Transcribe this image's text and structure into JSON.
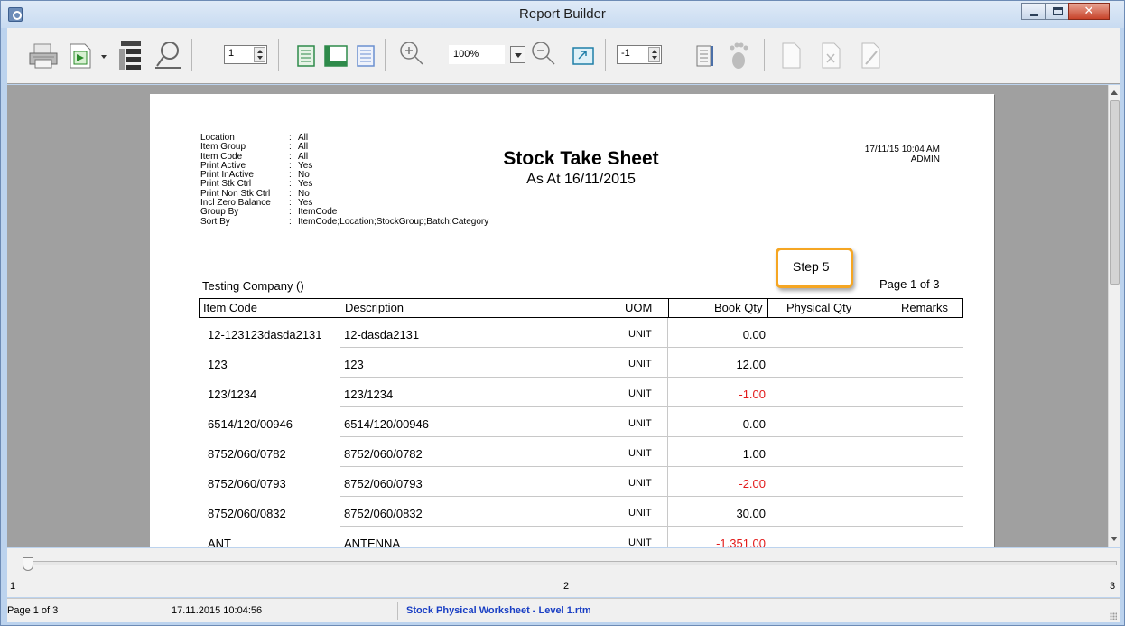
{
  "window": {
    "title": "Report Builder"
  },
  "toolbar": {
    "page_number": "1",
    "zoom": "100%",
    "offset": "-1",
    "buttons": [
      "print-icon",
      "export-icon",
      "outline-icon",
      "search-icon",
      "whole-page-icon",
      "page-width-icon",
      "hundred-percent-icon",
      "zoom-in-icon",
      "zoom-out-icon",
      "fit-icon",
      "two-pages-icon",
      "footprint-icon",
      "new-page-icon",
      "delete-page-icon",
      "edit-page-icon"
    ]
  },
  "report": {
    "title": "Stock Take Sheet",
    "subtitle": "As At 16/11/2015",
    "datetime": "17/11/15 10:04 AM",
    "user": "ADMIN",
    "params": [
      {
        "key": "Location",
        "value": "All"
      },
      {
        "key": "Item Group",
        "value": "All"
      },
      {
        "key": "Item Code",
        "value": "All"
      },
      {
        "key": "Print Active",
        "value": "Yes"
      },
      {
        "key": "Print InActive",
        "value": "No"
      },
      {
        "key": "Print Stk Ctrl",
        "value": "Yes"
      },
      {
        "key": "Print Non Stk Ctrl",
        "value": "No"
      },
      {
        "key": "Incl Zero Balance",
        "value": "Yes"
      },
      {
        "key": "Group By",
        "value": "ItemCode"
      },
      {
        "key": "Sort By",
        "value": "ItemCode;Location;StockGroup;Batch;Category"
      }
    ],
    "param_sep": ":",
    "company": "Testing Company ()",
    "page_info": "Page 1 of 3",
    "step_label": "Step 5",
    "columns": [
      "Item Code",
      "Description",
      "UOM",
      "Book Qty",
      "Physical Qty",
      "Remarks"
    ],
    "rows": [
      {
        "code": "12-123123dasda2131",
        "desc": "12-dasda2131",
        "uom": "UNIT",
        "qty": "0.00",
        "neg": false
      },
      {
        "code": "123",
        "desc": "123",
        "uom": "UNIT",
        "qty": "12.00",
        "neg": false
      },
      {
        "code": "123/1234",
        "desc": "123/1234",
        "uom": "UNIT",
        "qty": "-1.00",
        "neg": true
      },
      {
        "code": "6514/120/00946",
        "desc": "6514/120/00946",
        "uom": "UNIT",
        "qty": "0.00",
        "neg": false
      },
      {
        "code": "8752/060/0782",
        "desc": "8752/060/0782",
        "uom": "UNIT",
        "qty": "1.00",
        "neg": false
      },
      {
        "code": "8752/060/0793",
        "desc": "8752/060/0793",
        "uom": "UNIT",
        "qty": "-2.00",
        "neg": true
      },
      {
        "code": "8752/060/0832",
        "desc": "8752/060/0832",
        "uom": "UNIT",
        "qty": "30.00",
        "neg": false
      },
      {
        "code": "ANT",
        "desc": "ANTENNA",
        "uom": "UNIT",
        "qty": "-1,351.00",
        "neg": true
      }
    ]
  },
  "slider": {
    "min_label": "1",
    "mid_label": "2",
    "max_label": "3"
  },
  "status": {
    "page": "Page 1 of 3",
    "timestamp": "17.11.2015 10:04:56",
    "file": "Stock Physical Worksheet - Level 1.rtm"
  },
  "colors": {
    "negative": "#e21b1b",
    "step_border": "#f5a623",
    "status_file": "#1a3fc4"
  }
}
